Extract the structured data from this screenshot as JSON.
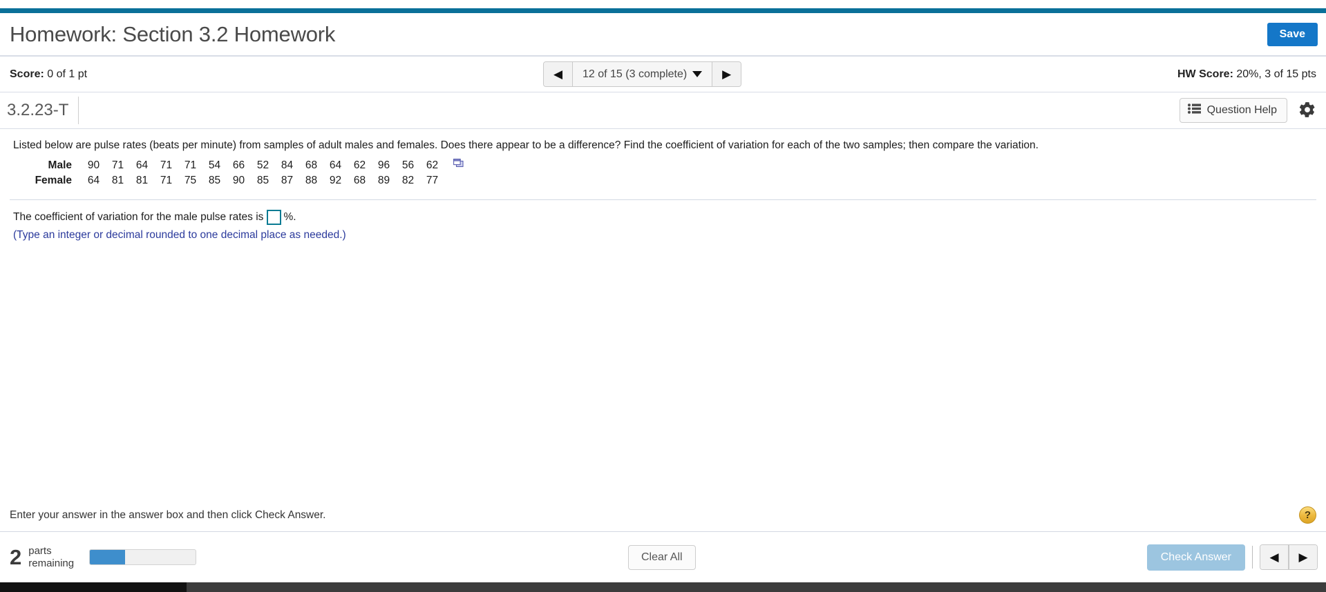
{
  "theme": {
    "teal_rule": "#0a7099",
    "save_blue": "#1477c8",
    "answer_border_teal": "#0a7b93",
    "hint_blue": "#2b3a9c",
    "progress_blue": "#3e8ecc",
    "check_answer_blue": "#9cc5e0",
    "help_badge_gold": "#ecb73c"
  },
  "header": {
    "title": "Homework: Section 3.2 Homework",
    "save_label": "Save"
  },
  "score_bar": {
    "score_label": "Score:",
    "score_value": "0 of 1 pt",
    "nav_prev_icon": "triangle-left-icon",
    "nav_next_icon": "triangle-right-icon",
    "question_selector": "12 of 15 (3 complete)",
    "hw_score_label": "HW Score:",
    "hw_score_value": "20%, 3 of 15 pts"
  },
  "question_bar": {
    "question_id": "3.2.23-T",
    "question_help_label": "Question Help",
    "question_help_icon": "list-icon",
    "settings_icon": "gear-icon"
  },
  "question": {
    "prompt": "Listed below are pulse rates (beats per minute) from samples of adult males and females. Does there appear to be a difference? Find the coefficient of variation for each of the two samples; then compare the variation.",
    "copy_icon": "copy-to-clipboard-icon",
    "table": {
      "rows": [
        {
          "label": "Male",
          "values": [
            "90",
            "71",
            "64",
            "71",
            "71",
            "54",
            "66",
            "52",
            "84",
            "68",
            "64",
            "62",
            "96",
            "56",
            "62"
          ]
        },
        {
          "label": "Female",
          "values": [
            "64",
            "81",
            "81",
            "71",
            "75",
            "85",
            "90",
            "85",
            "87",
            "88",
            "92",
            "68",
            "89",
            "82",
            "77"
          ]
        }
      ]
    }
  },
  "answer": {
    "text_before": "The coefficient of variation for the male pulse rates is",
    "input_value": "",
    "input_placeholder": "",
    "text_after": "%.",
    "hint": "(Type an integer or decimal rounded to one decimal place as needed.)"
  },
  "instruction": {
    "text": "Enter your answer in the answer box and then click Check Answer.",
    "help_badge_icon": "question-mark-icon",
    "help_badge_label": "?"
  },
  "footer": {
    "parts_number": "2",
    "parts_label_line1": "parts",
    "parts_label_line2": "remaining",
    "progress_percent": 33,
    "clear_all_label": "Clear All",
    "check_answer_label": "Check Answer",
    "prev_icon": "triangle-left-icon",
    "next_icon": "triangle-right-icon"
  }
}
